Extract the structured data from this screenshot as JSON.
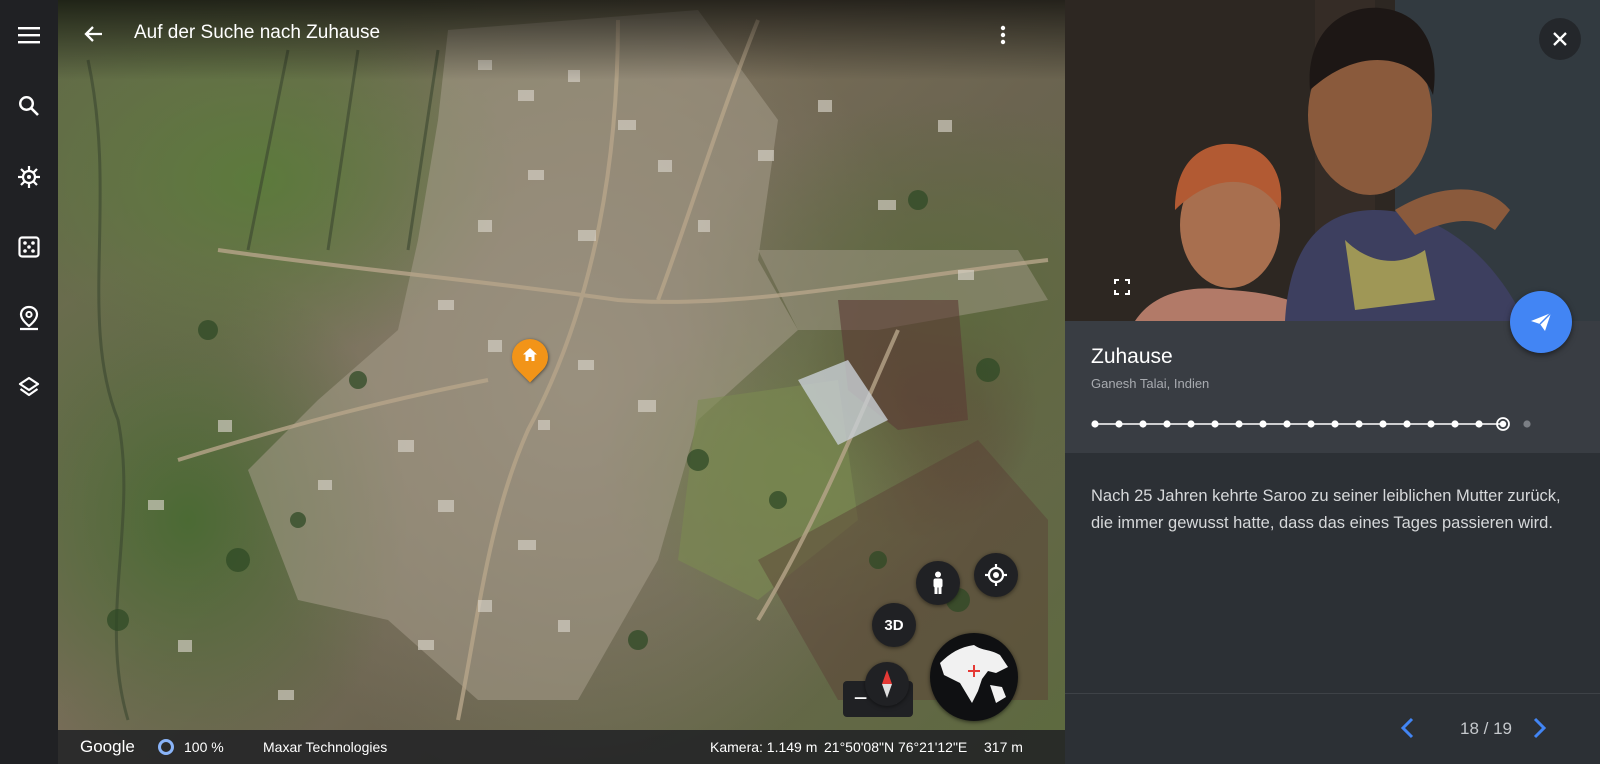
{
  "rail": {
    "items": [
      {
        "icon": "menu-icon"
      },
      {
        "icon": "search-icon"
      },
      {
        "icon": "voyager-icon"
      },
      {
        "icon": "feeling-lucky-dice-icon"
      },
      {
        "icon": "projects-pin-icon"
      },
      {
        "icon": "map-style-layers-icon"
      }
    ]
  },
  "map": {
    "title": "Auf der Suche nach Zuhause",
    "pin_icon": "home-icon",
    "view_3d_label": "3D",
    "zoom_out": "−",
    "zoom_in": "+"
  },
  "footer": {
    "brand": "Google",
    "load_percent": "100 %",
    "provider": "Maxar Technologies",
    "camera": "Kamera: 1.149 m",
    "coordinates": "21°50'08\"N 76°21'12\"E",
    "scale": "317 m"
  },
  "panel": {
    "title": "Zuhause",
    "subtitle": "Ganesh Talai, Indien",
    "description": "Nach 25 Jahren kehrte Saroo zu seiner leiblichen Mutter zurück, die immer gewusst hatte, dass das eines Tages passieren wird.",
    "progress": {
      "current": 18,
      "total": 19
    },
    "counter": "18 / 19",
    "colors": {
      "accent": "#4285f4",
      "pin": "#f29418"
    }
  }
}
